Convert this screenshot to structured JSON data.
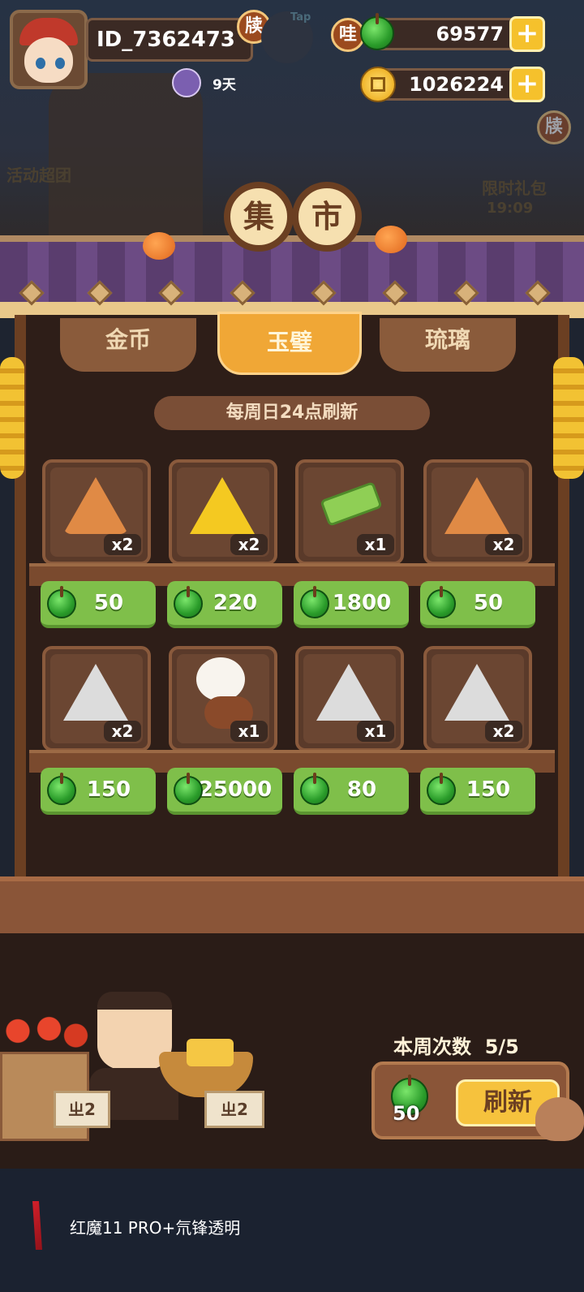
{
  "player": {
    "id": "ID_7362473",
    "days": "9天",
    "badge_left": "牍",
    "badge_right": "哇",
    "dim_chip": "Tap"
  },
  "currency": {
    "jade": "69577",
    "coins": "1026224"
  },
  "side_signs": {
    "left": "活动超团",
    "right_top": "牍",
    "right": "限时礼包",
    "right_sub": "19:09"
  },
  "market": {
    "title_chars": [
      "集",
      "市"
    ]
  },
  "tabs": [
    {
      "label": "金币",
      "active": false
    },
    {
      "label": "玉璧",
      "active": true
    },
    {
      "label": "琉璃",
      "active": false
    }
  ],
  "refresh_note": "每周日24点刷新",
  "items": [
    {
      "icon": "orange-triangle-token-icon",
      "qty": "x2",
      "price": "50"
    },
    {
      "icon": "yellow-spiral-token-icon",
      "qty": "x2",
      "price": "220"
    },
    {
      "icon": "green-jade-tablet-icon",
      "qty": "x1",
      "price": "1800"
    },
    {
      "icon": "orange-flower-token-icon",
      "qty": "x2",
      "price": "50"
    },
    {
      "icon": "white-leaf-token-icon",
      "qty": "x2",
      "price": "150"
    },
    {
      "icon": "bear-lute-player-icon",
      "qty": "x1",
      "price": "25000"
    },
    {
      "icon": "white-rune-token-icon",
      "qty": "x1",
      "price": "80"
    },
    {
      "icon": "white-wave-token-icon",
      "qty": "x2",
      "price": "150"
    }
  ],
  "weekly": {
    "label": "本周次数",
    "value": "5/5"
  },
  "refresh": {
    "cost": "50",
    "button": "刷新"
  },
  "vendor": {
    "sign_left": "ㄓ2",
    "sign_right": "ㄓ2"
  },
  "footer": {
    "brand": "红魔11 PRO+氘锋透明"
  },
  "colors": {
    "jade": "#3aa83a",
    "price_bg": "#7fbf4a",
    "tab_active": "#f0a736",
    "wood": "#8a5538"
  }
}
